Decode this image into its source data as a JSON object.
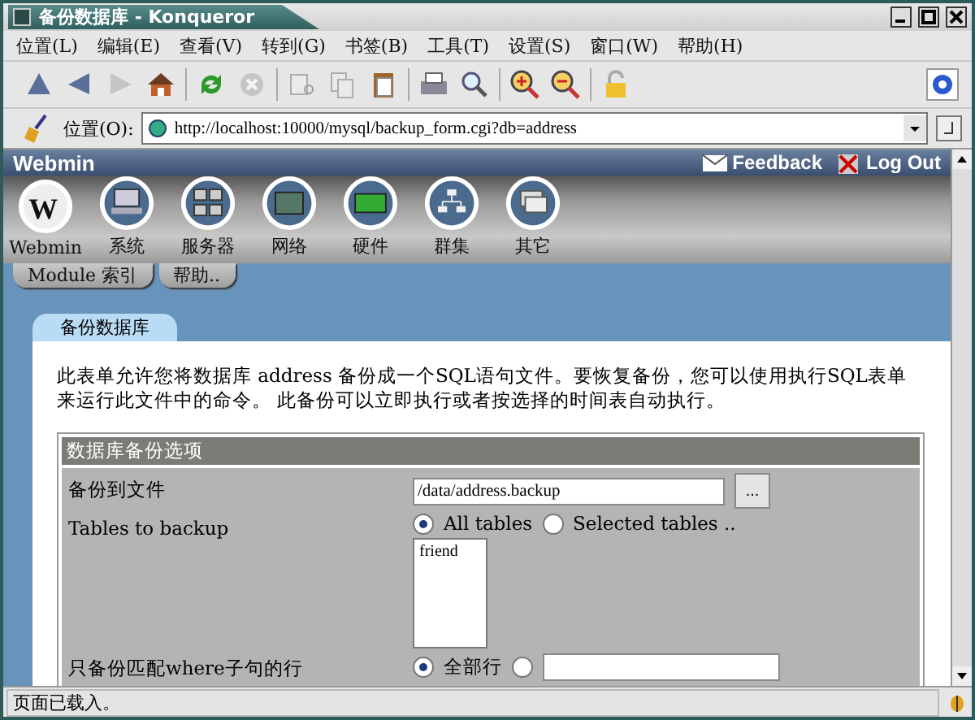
{
  "window": {
    "title": "备份数据库 - Konqueror"
  },
  "menu": [
    "位置(L)",
    "编辑(E)",
    "查看(V)",
    "转到(G)",
    "书签(B)",
    "工具(T)",
    "设置(S)",
    "窗口(W)",
    "帮助(H)"
  ],
  "toolbar": [
    {
      "kind": "up",
      "disabled": false
    },
    {
      "kind": "back",
      "disabled": false
    },
    {
      "kind": "forward",
      "disabled": true
    },
    {
      "kind": "home",
      "disabled": false
    },
    {
      "kind": "sep"
    },
    {
      "kind": "reload",
      "disabled": false
    },
    {
      "kind": "stop",
      "disabled": true
    },
    {
      "kind": "sep"
    },
    {
      "kind": "cut",
      "disabled": true
    },
    {
      "kind": "copy",
      "disabled": true
    },
    {
      "kind": "paste",
      "disabled": false
    },
    {
      "kind": "sep"
    },
    {
      "kind": "print",
      "disabled": false
    },
    {
      "kind": "find",
      "disabled": false
    },
    {
      "kind": "sep"
    },
    {
      "kind": "zoomin",
      "disabled": false
    },
    {
      "kind": "zoomout",
      "disabled": false
    },
    {
      "kind": "sep"
    },
    {
      "kind": "lock",
      "disabled": false
    }
  ],
  "location": {
    "label": "位置(O):",
    "url": "http://localhost:10000/mysql/backup_form.cgi?db=address"
  },
  "webmin_header": {
    "logo": "Webmin",
    "links": [
      {
        "label": "Feedback",
        "kind": "feedback"
      },
      {
        "label": "Log Out",
        "kind": "logout"
      }
    ]
  },
  "categories": [
    {
      "label": "Webmin",
      "kind": "webmin",
      "logo_letter": "W"
    },
    {
      "label": "系统",
      "kind": "system"
    },
    {
      "label": "服务器",
      "kind": "servers"
    },
    {
      "label": "网络",
      "kind": "network"
    },
    {
      "label": "硬件",
      "kind": "hardware"
    },
    {
      "label": "群集",
      "kind": "cluster"
    },
    {
      "label": "其它",
      "kind": "others"
    }
  ],
  "module_tabs": [
    "Module 索引",
    "帮助.."
  ],
  "page_tab": "备份数据库",
  "intro": "此表单允许您将数据库 address 备份成一个SQL语句文件。要恢复备份，您可以使用执行SQL表单来运行此文件中的命令。 此备份可以立即执行或者按选择的时间表自动执行。",
  "form": {
    "title": "数据库备份选项",
    "rows": [
      {
        "kind": "file",
        "label": "备份到文件",
        "value": "/data/address.backup",
        "button": "..."
      },
      {
        "kind": "tables",
        "label": "Tables to backup",
        "options": [
          {
            "label": "All tables",
            "selected": true
          },
          {
            "label": "Selected tables ..",
            "selected": false
          }
        ],
        "list": [
          "friend"
        ]
      },
      {
        "kind": "where",
        "label": "只备份匹配where子句的行",
        "options": [
          {
            "label": "全部行",
            "selected": true
          },
          {
            "selected": false
          }
        ]
      }
    ]
  },
  "status_bar": {
    "text": "页面已载入。"
  }
}
